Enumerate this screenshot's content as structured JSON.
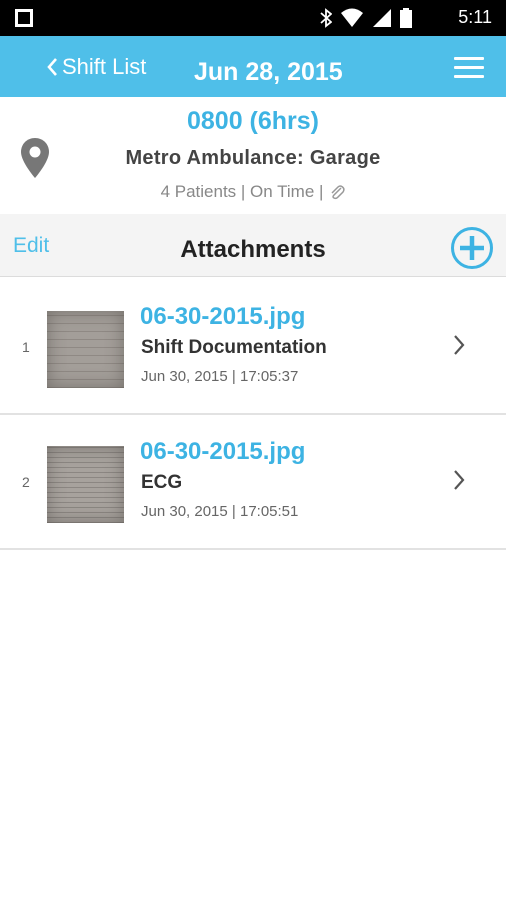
{
  "status_bar": {
    "time": "5:11",
    "icons": [
      "bluetooth-icon",
      "wifi-icon",
      "signal-icon",
      "battery-icon"
    ]
  },
  "header": {
    "back_label": "Shift List",
    "title": "Jun 28, 2015",
    "color": "#4fbfe9"
  },
  "shift": {
    "time": "0800 (6hrs)",
    "location": "Metro Ambulance: Garage",
    "meta": "4 Patients | On Time |"
  },
  "attachments_bar": {
    "edit_label": "Edit",
    "title": "Attachments"
  },
  "attachments": [
    {
      "index": "1",
      "file_name": "06-30-2015.jpg",
      "description": "Shift Documentation",
      "date": "Jun 30, 2015 | 17:05:37"
    },
    {
      "index": "2",
      "file_name": "06-30-2015.jpg",
      "description": "ECG",
      "date": "Jun 30, 2015 | 17:05:51"
    }
  ]
}
